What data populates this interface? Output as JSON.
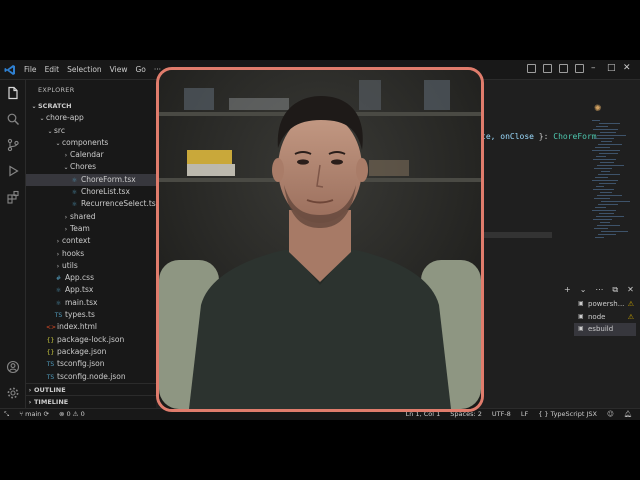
{
  "menu": [
    "File",
    "Edit",
    "Selection",
    "View",
    "Go",
    "···"
  ],
  "sidebar": {
    "title": "EXPLORER",
    "tree": [
      {
        "label": "SCRATCH",
        "depth": 0,
        "kind": "head",
        "chev": "⌄"
      },
      {
        "label": "chore-app",
        "depth": 1,
        "kind": "folder",
        "chev": "⌄"
      },
      {
        "label": "src",
        "depth": 2,
        "kind": "folder",
        "chev": "⌄"
      },
      {
        "label": "components",
        "depth": 3,
        "kind": "folder",
        "chev": "⌄"
      },
      {
        "label": "Calendar",
        "depth": 4,
        "kind": "folder",
        "chev": "›"
      },
      {
        "label": "Chores",
        "depth": 4,
        "kind": "folder",
        "chev": "⌄"
      },
      {
        "label": "ChoreForm.tsx",
        "depth": 5,
        "kind": "tsx",
        "selected": true
      },
      {
        "label": "ChoreList.tsx",
        "depth": 5,
        "kind": "tsx"
      },
      {
        "label": "RecurrenceSelect.tsx",
        "depth": 5,
        "kind": "tsx"
      },
      {
        "label": "shared",
        "depth": 4,
        "kind": "folder",
        "chev": "›"
      },
      {
        "label": "Team",
        "depth": 4,
        "kind": "folder",
        "chev": "›"
      },
      {
        "label": "context",
        "depth": 3,
        "kind": "folder",
        "chev": "›"
      },
      {
        "label": "hooks",
        "depth": 3,
        "kind": "folder",
        "chev": "›"
      },
      {
        "label": "utils",
        "depth": 3,
        "kind": "folder",
        "chev": "›"
      },
      {
        "label": "App.css",
        "depth": 3,
        "kind": "css"
      },
      {
        "label": "App.tsx",
        "depth": 3,
        "kind": "tsx"
      },
      {
        "label": "main.tsx",
        "depth": 3,
        "kind": "tsx"
      },
      {
        "label": "types.ts",
        "depth": 3,
        "kind": "ts"
      },
      {
        "label": "index.html",
        "depth": 2,
        "kind": "html"
      },
      {
        "label": "package-lock.json",
        "depth": 2,
        "kind": "json"
      },
      {
        "label": "package.json",
        "depth": 2,
        "kind": "json"
      },
      {
        "label": "tsconfig.json",
        "depth": 2,
        "kind": "ts"
      },
      {
        "label": "tsconfig.node.json",
        "depth": 2,
        "kind": "ts"
      }
    ],
    "outline": "OUTLINE",
    "timeline": "TIMELINE"
  },
  "editor": {
    "code_param": "te, onClose",
    "code_mid": " }: ",
    "code_type": "ChoreForm"
  },
  "terminal": {
    "toolbar": [
      "+",
      "⌄",
      "⋯",
      "⧉",
      "✕"
    ],
    "items": [
      {
        "label": "powersh...",
        "warn": true
      },
      {
        "label": "node",
        "warn": true
      },
      {
        "label": "esbuild",
        "warn": false,
        "selected": true
      }
    ]
  },
  "statusbar": {
    "branch": "main",
    "errors": "0",
    "warnings": "0",
    "position": "Ln 1, Col 1",
    "spaces": "Spaces: 2",
    "encoding": "UTF-8",
    "eol": "LF",
    "language": "{ } TypeScript JSX"
  },
  "colors": {
    "webcam_border": "#e07c6c",
    "accent": "#0078d4"
  }
}
